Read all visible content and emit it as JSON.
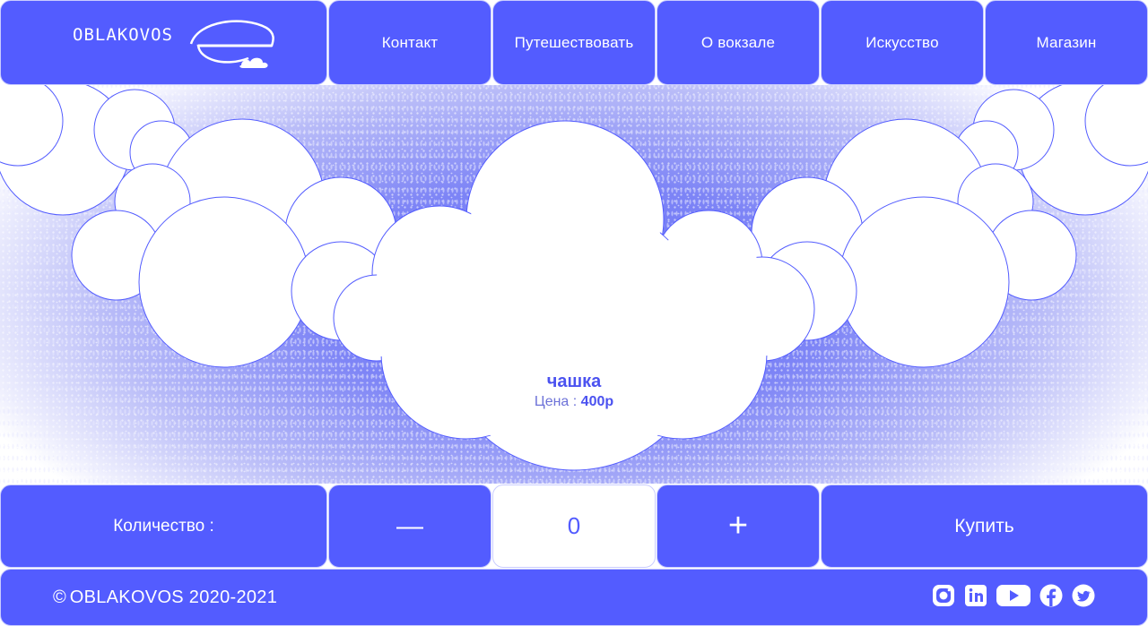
{
  "brand": {
    "logo_text": "OBLAKOVOS"
  },
  "nav": {
    "items": [
      {
        "id": "contact",
        "label": "Контакт"
      },
      {
        "id": "travel",
        "label": "Путешествовать"
      },
      {
        "id": "station",
        "label": "О вокзале"
      },
      {
        "id": "art",
        "label": "Искусство"
      },
      {
        "id": "shop",
        "label": "Магазин"
      }
    ]
  },
  "product": {
    "name": "чашка",
    "price_label": "Цена : ",
    "price_value": "400р"
  },
  "order": {
    "quantity_label": "Количество :",
    "minus_label": "—",
    "quantity_value": "0",
    "plus_label": "+",
    "buy_label": "Купить"
  },
  "footer": {
    "copyright_symbol": "©",
    "copyright_text": "OBLAKOVOS 2020-2021",
    "social_icons": [
      "instagram-icon",
      "linkedin-icon",
      "youtube-icon",
      "facebook-icon",
      "twitter-icon"
    ]
  },
  "colors": {
    "accent": "#535cff",
    "white": "#ffffff",
    "border": "#c9ccff"
  }
}
